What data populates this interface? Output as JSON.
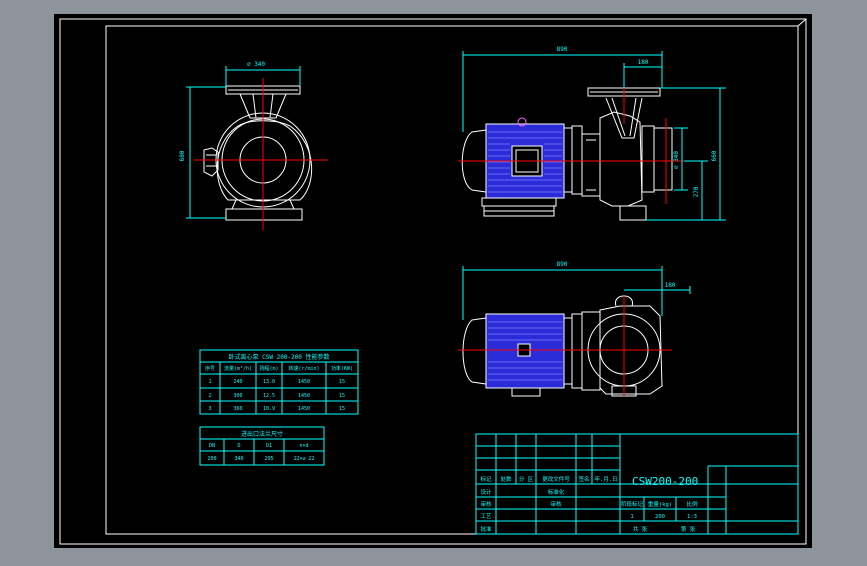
{
  "colors": {
    "viewport_bg": "#8e949b",
    "sheet_bg": "#000000",
    "frame": "#ffffff",
    "dimension": "#00ffff",
    "centerline": "#ff0000",
    "motor": "#2b2bd8",
    "drawing_lines": "#ffffff"
  },
  "front_view": {
    "dim_top": "⌀ 340",
    "dim_height": "600"
  },
  "side_view": {
    "dim_length": "890",
    "dim_flange_offset": "180",
    "dim_flange_dia": "⌀ 340",
    "dim_center_height": "270",
    "dim_total_height": "660"
  },
  "top_view": {
    "dim_length": "890",
    "dim_flange_offset": "180"
  },
  "param_table": {
    "title": "卧式离心泵 CSW 200-200 性能参数",
    "headers": [
      "序号",
      "流量(m³/h)",
      "扬程(m)",
      "转速(r/min)",
      "功率(KW)"
    ],
    "rows": [
      [
        "1",
        "240",
        "13.0",
        "1450",
        "15"
      ],
      [
        "2",
        "300",
        "12.5",
        "1450",
        "15"
      ],
      [
        "3",
        "360",
        "10.9",
        "1450",
        "15"
      ]
    ]
  },
  "flange_table": {
    "title": "进出口法兰尺寸",
    "headers": [
      "DN",
      "D",
      "D1",
      "n×d"
    ],
    "rows": [
      [
        "200",
        "340",
        "295",
        "12×⌀ 22"
      ]
    ]
  },
  "title_block": {
    "drawing_title": "CSW200-200",
    "labels_row1": [
      "标记",
      "处数",
      "分 区",
      "更改文件号",
      "签名",
      "年.月.日"
    ],
    "label_design": "设计",
    "label_standard": "标准化",
    "label_check": "审核",
    "label_audit": "审核",
    "label_process": "工艺",
    "label_approve": "批准",
    "label_stage": "阶段标记",
    "label_weight": "重量(kg)",
    "label_scale": "比例",
    "weight_value": "200",
    "scale_value": "1:3",
    "quantity_value": "1",
    "label_sheets": "共 张",
    "label_sheet": "第 张"
  }
}
